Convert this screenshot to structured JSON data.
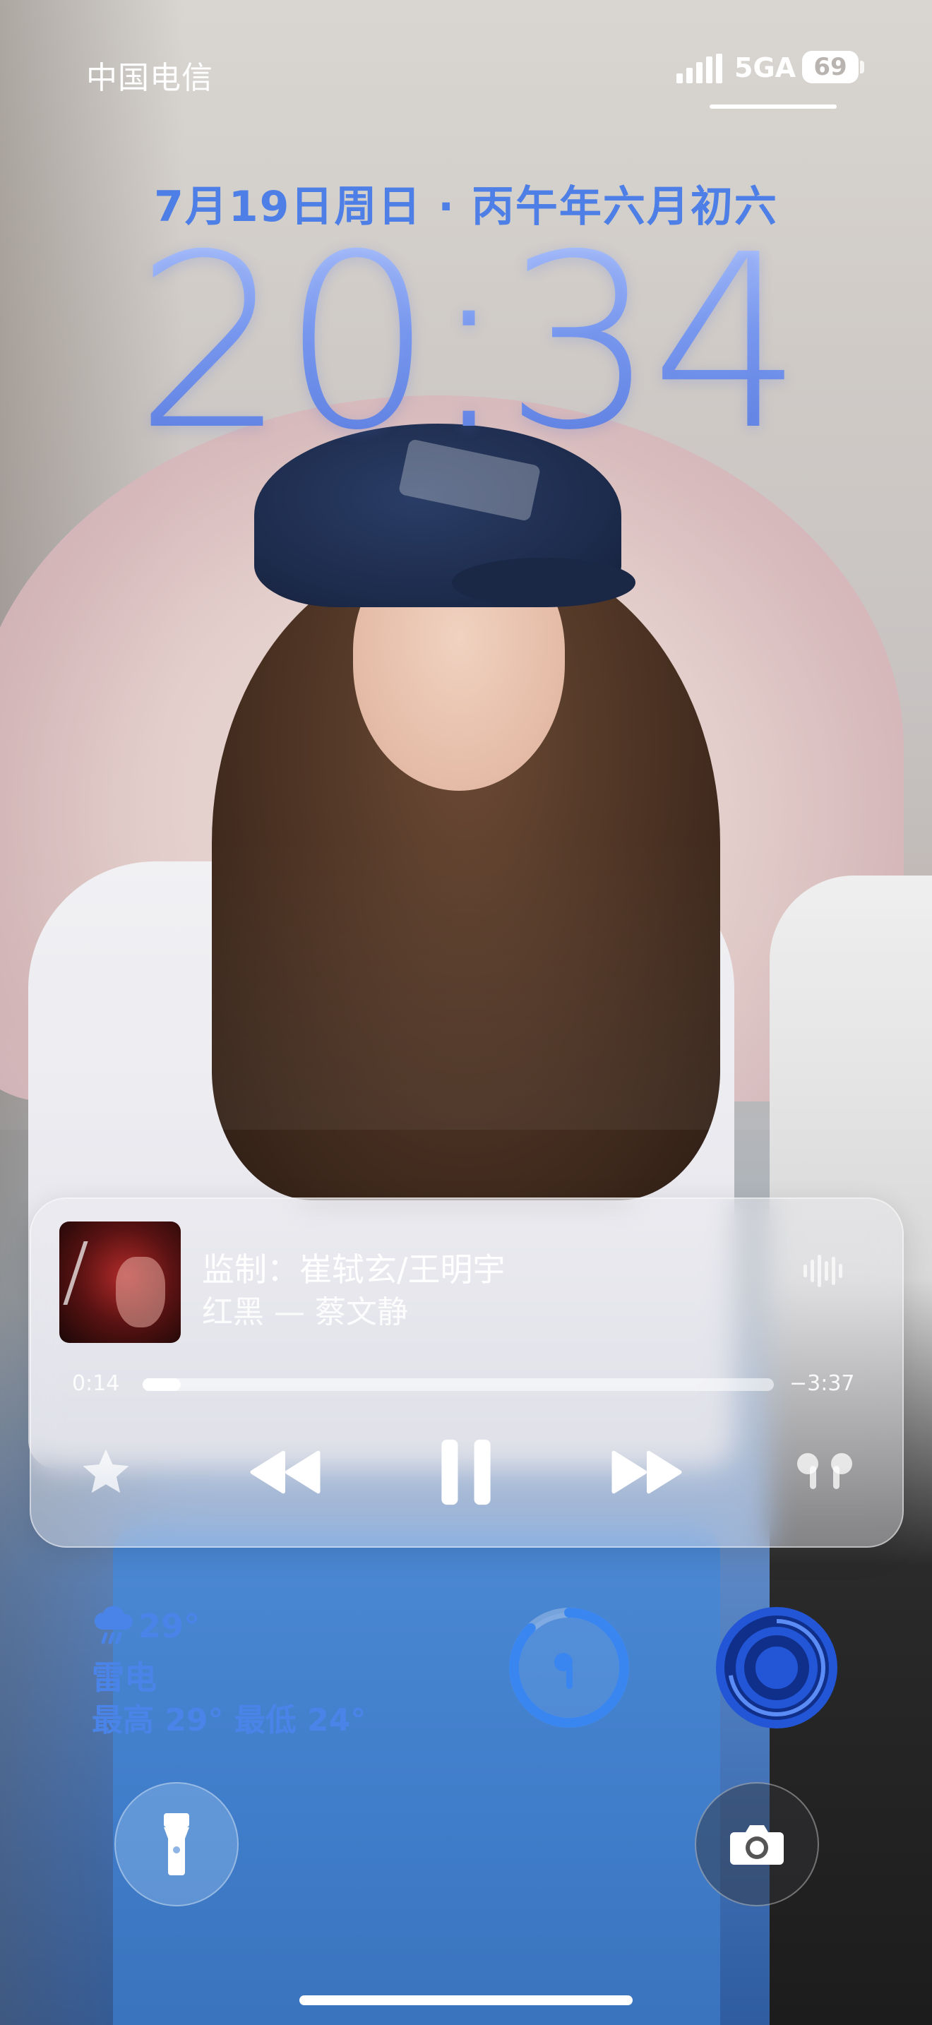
{
  "status_bar": {
    "carrier": "中国电信",
    "network": "5GA",
    "battery": "69"
  },
  "lock_screen": {
    "date": "7月19日周日 · 丙午年六月初六",
    "time": "20:34"
  },
  "now_playing": {
    "title": "监制：崔轼玄/王明宇",
    "subtitle": "红黑 — 蔡文静",
    "elapsed": "0:14",
    "remaining": "−3:37",
    "progress": 0.06,
    "controls": {
      "favorite_icon": "star-icon",
      "previous_icon": "rewind-icon",
      "play_pause_icon": "pause-icon",
      "next_icon": "fast-forward-icon",
      "output_icon": "airpods-icon"
    }
  },
  "weather": {
    "icon": "thunderstorm-icon",
    "temperature": "29°",
    "condition": "雷电",
    "high_low": "最高 29° 最低 24°"
  },
  "widgets": {
    "airpods_battery_icon": "airpods-ring-icon",
    "fitness_icon": "activity-ring-icon"
  },
  "quick_actions": {
    "left_icon": "flashlight-icon",
    "right_icon": "camera-icon"
  },
  "colors": {
    "accent_blue": "#4b84e8",
    "clock_blue": "#7d9df2",
    "ring_blue": "#3a86f0",
    "fitness_blue": "#2356d6"
  }
}
